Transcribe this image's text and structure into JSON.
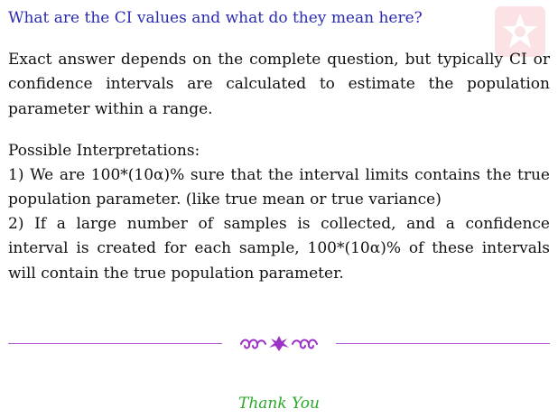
{
  "question": {
    "text": "What are the CI values and what do they mean here?"
  },
  "answer": {
    "paragraph_1": "Exact answer depends on the complete question, but typically CI or confi­dence intervals are calculated to estimate the population parameter within a range.",
    "interpretations_title": "Possible Interpretations:",
    "interpretation_1": "1) We are 100*(10α)% sure that the interval limits contains the true population parameter. (like true mean or true variance)",
    "interpretation_2": "2) If a large number of samples is collected, and a confidence interval is created for each sample, 100*(10α)% of these intervals will contain the true population parameter."
  },
  "footer": {
    "thanks": "Thank You"
  },
  "colors": {
    "question": "#2b2bb0",
    "divider": "#b35fd9",
    "ornament": "#9b30c9",
    "thanks": "#2aa82a",
    "logo_background": "#fbe3e5",
    "logo_mark": "#ffffff"
  },
  "icons": {
    "logo": "star-badge-icon",
    "ornament": "floral-divider-icon"
  }
}
